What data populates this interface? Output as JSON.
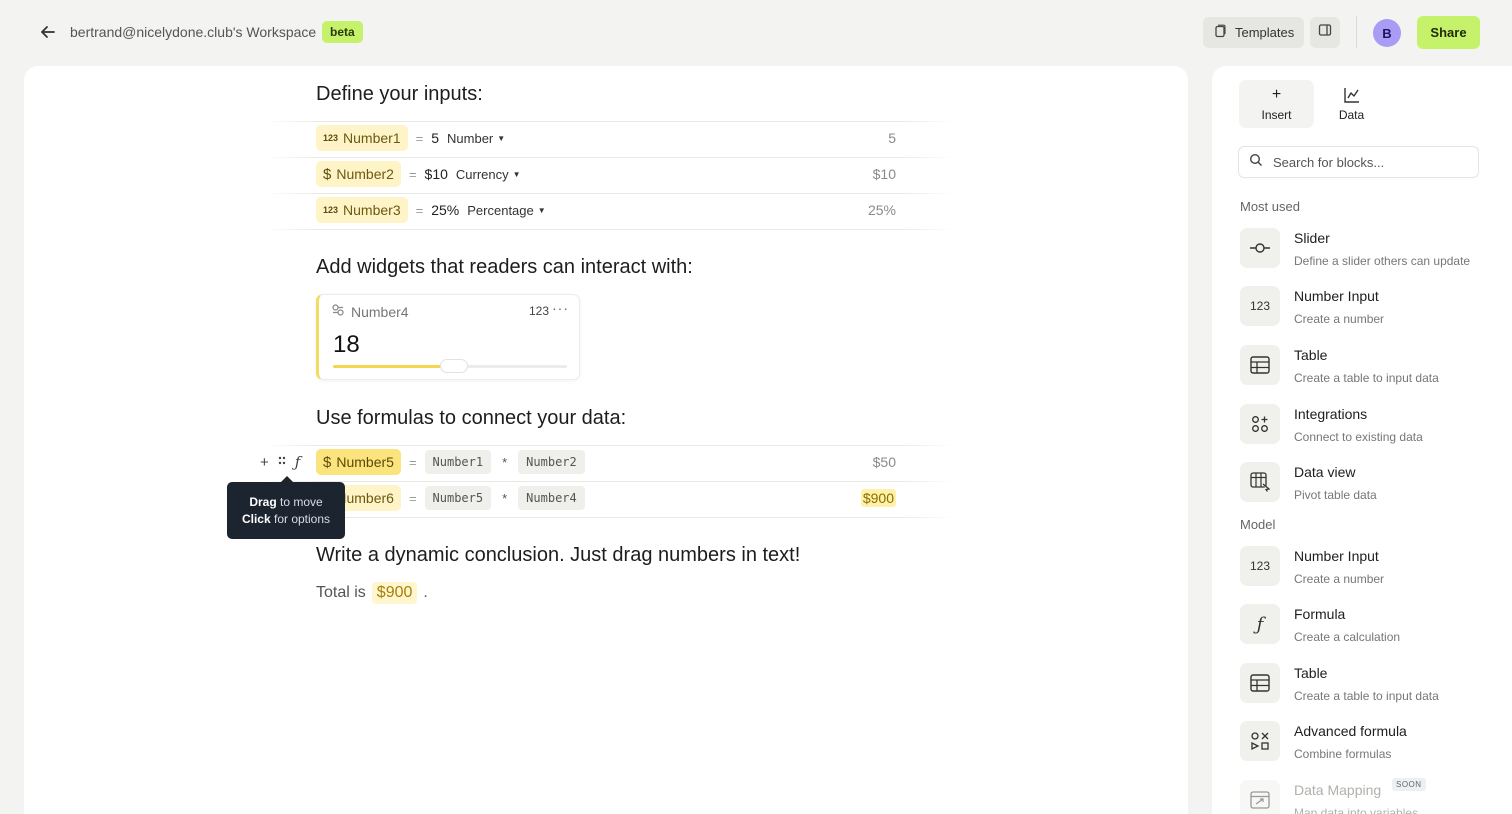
{
  "header": {
    "workspace_title": "bertrand@nicelydone.club's Workspace",
    "beta": "beta",
    "templates_label": "Templates",
    "avatar_initial": "B",
    "share_label": "Share"
  },
  "doc": {
    "inputs_heading": "Define your inputs:",
    "inputs": [
      {
        "icon": "123",
        "name": "Number1",
        "eq": "=",
        "value": "5",
        "type": "Number",
        "result": "5"
      },
      {
        "icon": "$",
        "name": "Number2",
        "eq": "=",
        "value": "$10",
        "type": "Currency",
        "result": "$10"
      },
      {
        "icon": "123",
        "name": "Number3",
        "eq": "=",
        "value": "25%",
        "type": "Percentage",
        "result": "25%"
      }
    ],
    "widgets_heading": "Add widgets that readers can interact with:",
    "widget": {
      "name": "Number4",
      "type": "123",
      "more": "···",
      "value": "18",
      "slider_fraction": 0.52
    },
    "formulas_heading": "Use formulas to connect your data:",
    "formulas": [
      {
        "icon": "$",
        "name": "Number5",
        "eq": "=",
        "a": "Number1",
        "op": "*",
        "b": "Number2",
        "result": "$50"
      },
      {
        "icon": "$",
        "name": "Number6",
        "eq": "=",
        "a": "Number5",
        "op": "*",
        "b": "Number4",
        "result": "$900"
      }
    ],
    "tooltip": {
      "drag_bold": "Drag",
      "drag_rest": "to move",
      "click_bold": "Click",
      "click_rest": "for options"
    },
    "conclusion_heading": "Write a dynamic conclusion. Just drag numbers in text!",
    "conclusion": {
      "prefix": "Total is",
      "value": "$900",
      "suffix": "."
    }
  },
  "panel": {
    "tabs": [
      {
        "label": "Insert",
        "icon": "plus-icon"
      },
      {
        "label": "Data",
        "icon": "chart-icon"
      }
    ],
    "search_placeholder": "Search for blocks...",
    "most_used_label": "Most used",
    "most_used": [
      {
        "name": "Slider",
        "desc": "Define a slider others can update",
        "icon": "slider-icon"
      },
      {
        "name": "Number Input",
        "desc": "Create a number",
        "icon": "123"
      },
      {
        "name": "Table",
        "desc": "Create a table to input data",
        "icon": "table-icon"
      },
      {
        "name": "Integrations",
        "desc": "Connect to existing data",
        "icon": "integrations-icon"
      },
      {
        "name": "Data view",
        "desc": "Pivot table data",
        "icon": "data-view-icon"
      }
    ],
    "model_label": "Model",
    "model": [
      {
        "name": "Number Input",
        "desc": "Create a number",
        "icon": "123"
      },
      {
        "name": "Formula",
        "desc": "Create a calculation",
        "icon": "formula-icon"
      },
      {
        "name": "Table",
        "desc": "Create a table to input data",
        "icon": "table-icon"
      },
      {
        "name": "Advanced formula",
        "desc": "Combine formulas",
        "icon": "advanced-formula-icon"
      },
      {
        "name": "Data Mapping",
        "desc": "Map data into variables",
        "badge": "SOON",
        "icon": "data-mapping-icon"
      }
    ]
  },
  "colors": {
    "accent_green": "#c6f26b",
    "variable_yellow": "#fff4c7",
    "avatar_purple": "#a89cf5"
  }
}
